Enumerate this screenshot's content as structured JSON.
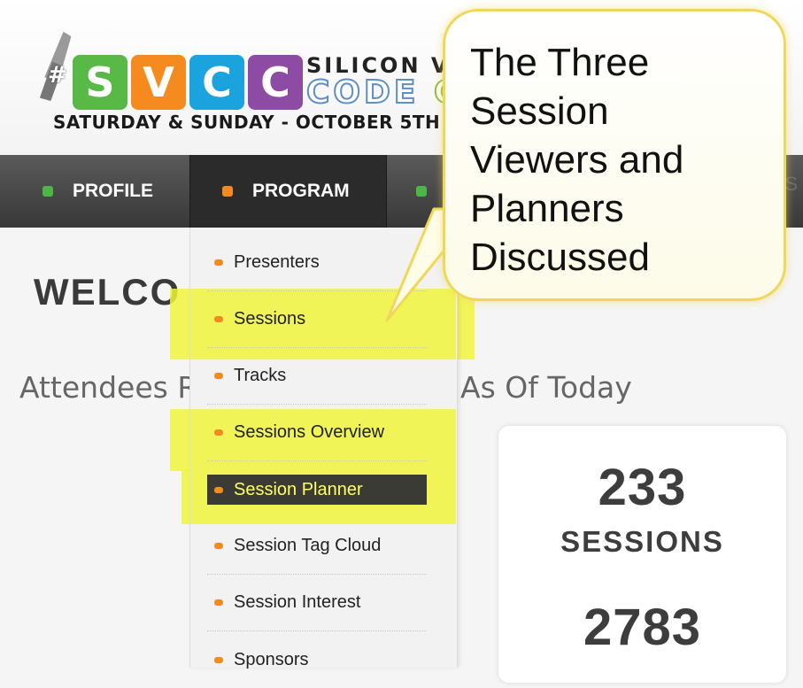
{
  "header": {
    "logo_hash": "#",
    "logo_letters": [
      "S",
      "V",
      "C",
      "C"
    ],
    "brand_line1": "SILICON V",
    "brand_line2a": "CODE",
    "brand_line2b": "C",
    "tagline": "SATURDAY & SUNDAY - OCTOBER 5TH & 6"
  },
  "nav": {
    "items": [
      {
        "label": "PROFILE",
        "dot_color": "#4cb648"
      },
      {
        "label": "PROGRAM",
        "dot_color": "#f58b1f"
      },
      {
        "label": "",
        "dot_color": "#4cb648"
      }
    ],
    "right_fragment": "S"
  },
  "dropdown": {
    "items": [
      {
        "label": "Presenters"
      },
      {
        "label": "Sessions"
      },
      {
        "label": "Tracks"
      },
      {
        "label": "Sessions Overview"
      },
      {
        "label": "Session Planner",
        "active": true
      },
      {
        "label": "Session Tag Cloud"
      },
      {
        "label": "Session Interest"
      },
      {
        "label": "Sponsors"
      }
    ]
  },
  "main": {
    "welcome": "WELCO",
    "attendees_left": "Attendees R",
    "attendees_right": "As Of Today",
    "stats": [
      {
        "value": "233",
        "label": "SESSIONS"
      },
      {
        "value": "2783",
        "label": ""
      }
    ]
  },
  "callout": {
    "lines": [
      "The Three",
      "Session",
      "Viewers and",
      "Planners",
      "Discussed"
    ]
  },
  "colors": {
    "highlight": "#f3f54a",
    "callout_border": "#f0d75a",
    "bullet": "#f58b1f",
    "active_bg": "#3b3b35",
    "active_text": "#ffff66"
  }
}
